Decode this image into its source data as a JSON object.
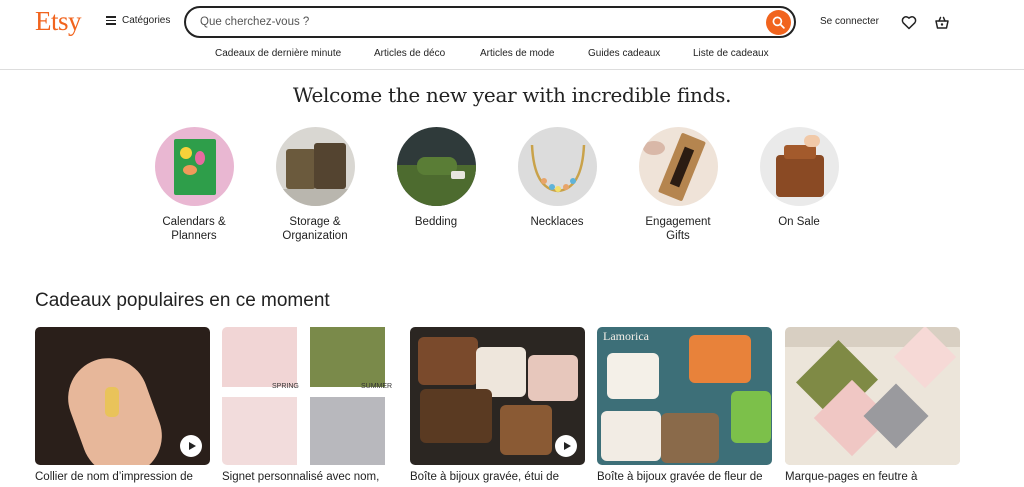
{
  "header": {
    "logo": "Etsy",
    "categories_label": "Catégories",
    "search_placeholder": "Que cherchez-vous ?",
    "sign_in": "Se connecter"
  },
  "subnav": [
    "Cadeaux de dernière minute",
    "Articles de déco",
    "Articles de mode",
    "Guides cadeaux",
    "Liste de cadeaux"
  ],
  "welcome": "Welcome the new year with incredible finds.",
  "circles": [
    {
      "label1": "Calendars &",
      "label2": "Planners"
    },
    {
      "label1": "Storage &",
      "label2": "Organization"
    },
    {
      "label1": "Bedding",
      "label2": ""
    },
    {
      "label1": "Necklaces",
      "label2": ""
    },
    {
      "label1": "Engagement",
      "label2": "Gifts"
    },
    {
      "label1": "On Sale",
      "label2": ""
    }
  ],
  "section_title": "Cadeaux populaires en ce moment",
  "cards": [
    {
      "title": "Collier de nom d’impression de"
    },
    {
      "title": "Signet personnalisé avec nom,",
      "tag1": "SPRING",
      "tag2": "SUMMER"
    },
    {
      "title": "Boîte à bijoux gravée, étui de"
    },
    {
      "title": "Boîte à bijoux gravée de fleur de",
      "brand": "Lamorica"
    },
    {
      "title": "Marque-pages en feutre à"
    }
  ],
  "colors": {
    "brand": "#f1641e",
    "text": "#222222"
  }
}
